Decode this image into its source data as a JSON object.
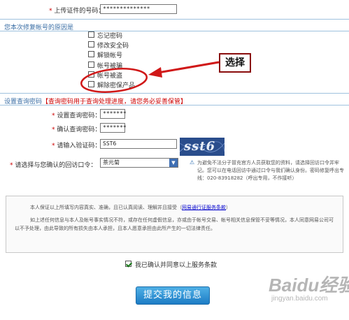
{
  "top": {
    "label": "上传证件的号码：",
    "value": "**************"
  },
  "reason": {
    "title": "您本次修复帐号的原因是",
    "options": [
      {
        "label": "忘记密码",
        "checked": false
      },
      {
        "label": "修改安全码",
        "checked": false
      },
      {
        "label": "解锁帐号",
        "checked": false
      },
      {
        "label": "帐号被骗",
        "checked": false
      },
      {
        "label": "帐号被盗",
        "checked": false
      },
      {
        "label": "解除密保产品",
        "checked": false
      }
    ]
  },
  "annotation": {
    "label": "选择",
    "color": "#cc1111"
  },
  "query_pw": {
    "title_a": "设置查询密码",
    "title_b": "【查询密码用于查询处理进度，请您务必妥善保管】",
    "set_label": "设置查询密码：",
    "set_value": "*******",
    "confirm_label": "确认查询密码：",
    "confirm_value": "*******",
    "captcha_label": "请输入验证码：",
    "captcha_value": "SST6",
    "captcha_image_text": "sst6",
    "question_label": "请选择与您确认的回访口令：",
    "question_value": "茶元菊",
    "note": "为避免不法分子冒充官方人员获取您的资料，请选择回访口令并牢记。您可以在电话回访中通过口令与我们确认身份。密码修复呼出专线：020-83918282（呼出专用，不作接听）"
  },
  "terms": {
    "p1_a": "本人保证以上所填写内容真实、准确，且已认真阅读、理解并且接受（",
    "p1_link": "网易通行证服务条款",
    "p1_b": "）",
    "p2": "如上述任何信息与本人及帐号事实情况不符，或存在任何虚假信息，亦或由于帐号交易、帐号相关信息保管不妥等情况，本人同意网易公司可以不予处理，由此导致的所有损失由本人承担，且本人愿意承担由此所产生的一切法律责任。"
  },
  "agree": {
    "label": "我已确认并同意以上服务条款",
    "checked": true
  },
  "submit": {
    "label": "提交我的信息"
  },
  "watermark": {
    "main": "Baidu经验",
    "sub": "jingyan.baidu.com"
  }
}
